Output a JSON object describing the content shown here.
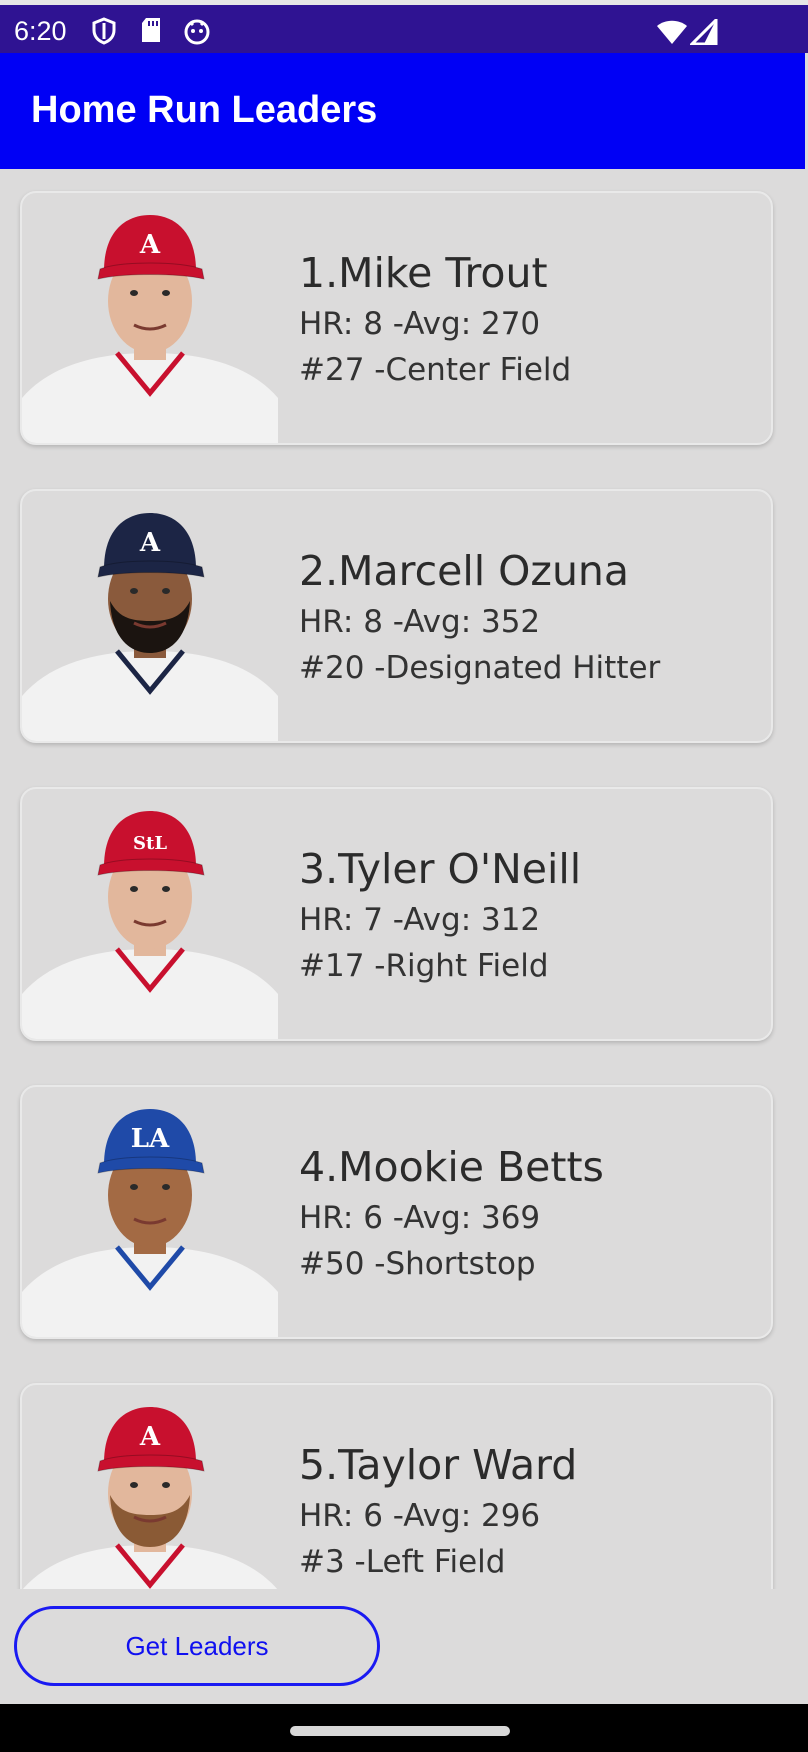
{
  "status_bar": {
    "time": "6:20",
    "icons": [
      "shield-icon",
      "sd-card-icon",
      "face-icon",
      "wifi-icon",
      "signal-icon"
    ]
  },
  "app_bar": {
    "title": "Home Run Leaders"
  },
  "colors": {
    "status_bar": "#2f1392",
    "app_bar": "#0000f5",
    "background": "#dcdbdb",
    "button_accent": "#1a1af2"
  },
  "players": [
    {
      "name": "1.Mike Trout",
      "stats": "HR: 8 -Avg: 270",
      "position": "#27 -Center Field",
      "cap_color": "#c8102e",
      "logo": "A",
      "beard": false
    },
    {
      "name": "2.Marcell Ozuna",
      "stats": "HR: 8 -Avg: 352",
      "position": "#20 -Designated Hitter",
      "cap_color": "#1c2545",
      "logo": "A",
      "beard": true
    },
    {
      "name": "3.Tyler O'Neill",
      "stats": "HR: 7 -Avg: 312",
      "position": "#17 -Right Field",
      "cap_color": "#c8102e",
      "logo": "StL",
      "beard": false
    },
    {
      "name": "4.Mookie Betts",
      "stats": "HR: 6 -Avg: 369",
      "position": "#50 -Shortstop",
      "cap_color": "#1f4aa8",
      "logo": "LA",
      "beard": false
    },
    {
      "name": "5.Taylor Ward",
      "stats": "HR: 6 -Avg: 296",
      "position": "#3 -Left Field",
      "cap_color": "#c8102e",
      "logo": "A",
      "beard": true
    }
  ],
  "get_leaders_button": {
    "label": "Get Leaders"
  }
}
